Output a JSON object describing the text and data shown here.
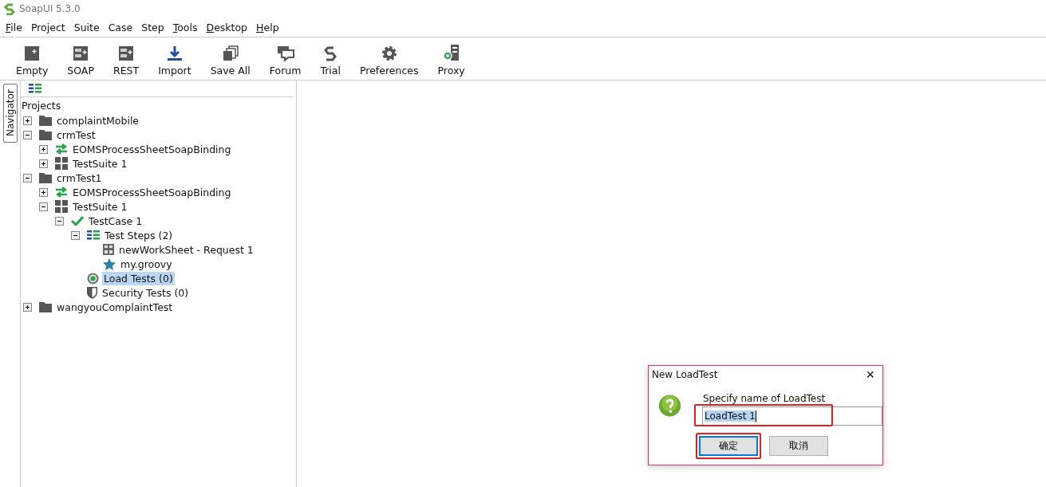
{
  "window": {
    "title": "SoapUI 5.3.0"
  },
  "menu": [
    {
      "label": "File",
      "mnemonic": true
    },
    {
      "label": "Project",
      "mnemonic": false
    },
    {
      "label": "Suite",
      "mnemonic": false
    },
    {
      "label": "Case",
      "mnemonic": false
    },
    {
      "label": "Step",
      "mnemonic": false
    },
    {
      "label": "Tools",
      "mnemonic": true
    },
    {
      "label": "Desktop",
      "mnemonic": true
    },
    {
      "label": "Help",
      "mnemonic": true
    }
  ],
  "toolbar": [
    {
      "kind": "empty",
      "label": "Empty"
    },
    {
      "kind": "soap",
      "label": "SOAP"
    },
    {
      "kind": "rest",
      "label": "REST"
    },
    {
      "kind": "import",
      "label": "Import"
    },
    {
      "kind": "saveall",
      "label": "Save All"
    },
    {
      "kind": "forum",
      "label": "Forum"
    },
    {
      "kind": "trial",
      "label": "Trial"
    },
    {
      "kind": "preferences",
      "label": "Preferences"
    },
    {
      "kind": "proxy",
      "label": "Proxy"
    }
  ],
  "side_tab": {
    "label": "Navigator"
  },
  "tree": {
    "root": "Projects",
    "children": [
      {
        "kind": "project",
        "label": "complaintMobile",
        "expanded": false,
        "selected": false
      },
      {
        "kind": "project",
        "label": "crmTest",
        "expanded": true,
        "selected": false,
        "children": [
          {
            "kind": "interface",
            "label": "EOMSProcessSheetSoapBinding",
            "expanded": false,
            "selected": false
          },
          {
            "kind": "suite",
            "label": "TestSuite 1",
            "expanded": false,
            "selected": false
          }
        ]
      },
      {
        "kind": "project",
        "label": "crmTest1",
        "expanded": true,
        "selected": false,
        "children": [
          {
            "kind": "interface",
            "label": "EOMSProcessSheetSoapBinding",
            "expanded": false,
            "selected": false
          },
          {
            "kind": "suite",
            "label": "TestSuite 1",
            "expanded": true,
            "selected": false,
            "children": [
              {
                "kind": "case",
                "label": "TestCase 1",
                "expanded": true,
                "selected": false,
                "children": [
                  {
                    "kind": "steps",
                    "label": "Test Steps (2)",
                    "expanded": true,
                    "selected": false,
                    "children": [
                      {
                        "kind": "request",
                        "label": "newWorkSheet - Request 1",
                        "selected": false
                      },
                      {
                        "kind": "groovy",
                        "label": "my.groovy",
                        "selected": false
                      }
                    ]
                  },
                  {
                    "kind": "load",
                    "label": "Load Tests (0)",
                    "selected": true
                  },
                  {
                    "kind": "security",
                    "label": "Security Tests (0)",
                    "selected": false
                  }
                ]
              }
            ]
          }
        ]
      },
      {
        "kind": "project",
        "label": "wangyouComplaintTest",
        "expanded": false,
        "selected": false
      }
    ]
  },
  "dialog": {
    "title": "New LoadTest",
    "close": "×",
    "prompt": "Specify name of LoadTest",
    "value": "LoadTest 1",
    "value_selected": true,
    "field_highlighted": true,
    "buttons": [
      {
        "label": "确定",
        "default": true,
        "highlighted": true
      },
      {
        "label": "取消",
        "default": false,
        "highlighted": false
      }
    ]
  }
}
